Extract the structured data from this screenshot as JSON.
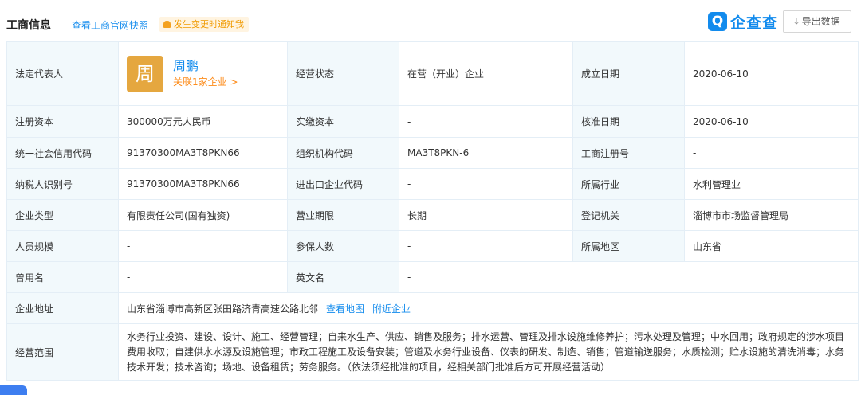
{
  "header": {
    "title": "工商信息",
    "snapshot_link": "查看工商官网快照",
    "notify_label": "发生变更时通知我",
    "brand_mark": "Q",
    "brand_name": "企查查",
    "export_label": "导出数据"
  },
  "colors": {
    "accent": "#128bed",
    "orange": "#fd8c1b",
    "label_bg": "#f2f9fc",
    "border": "#e4eef6"
  },
  "rep": {
    "label": "法定代表人",
    "avatar_char": "周",
    "name": "周鹏",
    "assoc": "关联1家企业 >"
  },
  "rows": {
    "status": {
      "label": "经营状态",
      "value": "在营（开业）企业"
    },
    "est": {
      "label": "成立日期",
      "value": "2020-06-10"
    },
    "reg_cap": {
      "label": "注册资本",
      "value": "300000万元人民币"
    },
    "paid_cap": {
      "label": "实缴资本",
      "value": "-"
    },
    "approve": {
      "label": "核准日期",
      "value": "2020-06-10"
    },
    "credit": {
      "label": "统一社会信用代码",
      "value": "91370300MA3T8PKN66"
    },
    "org": {
      "label": "组织机构代码",
      "value": "MA3T8PKN-6"
    },
    "biz_reg": {
      "label": "工商注册号",
      "value": "-"
    },
    "tax": {
      "label": "纳税人识别号",
      "value": "91370300MA3T8PKN66"
    },
    "import": {
      "label": "进出口企业代码",
      "value": "-"
    },
    "industry": {
      "label": "所属行业",
      "value": "水利管理业"
    },
    "type": {
      "label": "企业类型",
      "value": "有限责任公司(国有独资)"
    },
    "term": {
      "label": "营业期限",
      "value": "长期"
    },
    "authority": {
      "label": "登记机关",
      "value": "淄博市市场监督管理局"
    },
    "staff": {
      "label": "人员规模",
      "value": "-"
    },
    "insured": {
      "label": "参保人数",
      "value": "-"
    },
    "region": {
      "label": "所属地区",
      "value": "山东省"
    },
    "former": {
      "label": "曾用名",
      "value": "-"
    },
    "english": {
      "label": "英文名",
      "value": "-"
    },
    "address": {
      "label": "企业地址",
      "value": "山东省淄博市高新区张田路济青高速公路北邻",
      "map_link": "查看地图",
      "nearby_link": "附近企业"
    },
    "scope": {
      "label": "经营范围",
      "value": "水务行业投资、建设、设计、施工、经营管理；自来水生产、供应、销售及服务；排水运营、管理及排水设施维修养护；污水处理及管理；中水回用；政府规定的涉水项目费用收取；自建供水水源及设施管理；市政工程施工及设备安装；管道及水务行业设备、仪表的研发、制造、销售；管道输送服务；水质检测；贮水设施的清洗消毒；水务技术开发；技术咨询；场地、设备租赁；劳务服务。（依法须经批准的项目，经相关部门批准后方可开展经营活动）"
    }
  }
}
